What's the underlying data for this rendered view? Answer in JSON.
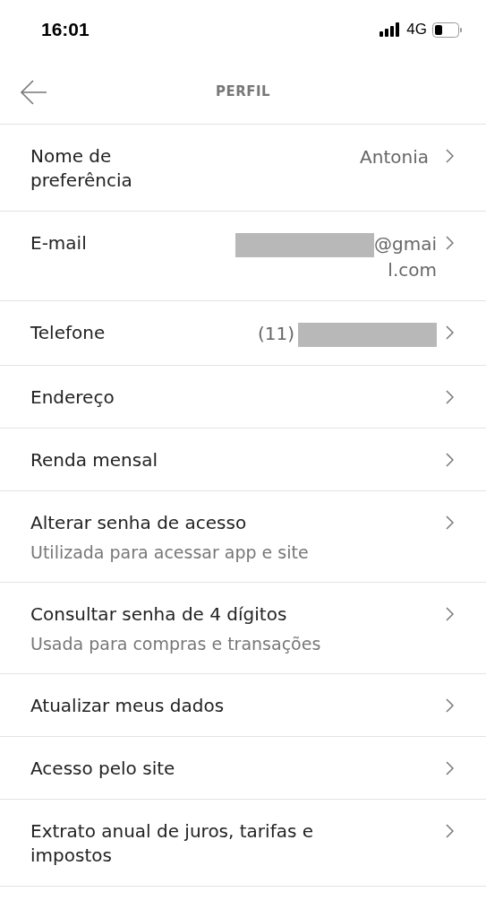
{
  "status_bar": {
    "time": "16:01",
    "network": "4G"
  },
  "header": {
    "title": "PERFIL"
  },
  "rows": [
    {
      "label": "Nome de preferência",
      "value": "Antonia"
    },
    {
      "label": "E-mail",
      "value": "@gmail.com",
      "redacted": true
    },
    {
      "label": "Telefone",
      "value": "(11)",
      "redacted": true
    },
    {
      "label": "Endereço"
    },
    {
      "label": "Renda mensal"
    },
    {
      "label": "Alterar senha de acesso",
      "subtitle": "Utilizada para acessar app e site"
    },
    {
      "label": "Consultar senha de 4 dígitos",
      "subtitle": "Usada para compras e transações"
    },
    {
      "label": "Atualizar meus dados"
    },
    {
      "label": "Acesso pelo site"
    },
    {
      "label": "Extrato anual de juros, tarifas e impostos"
    }
  ]
}
